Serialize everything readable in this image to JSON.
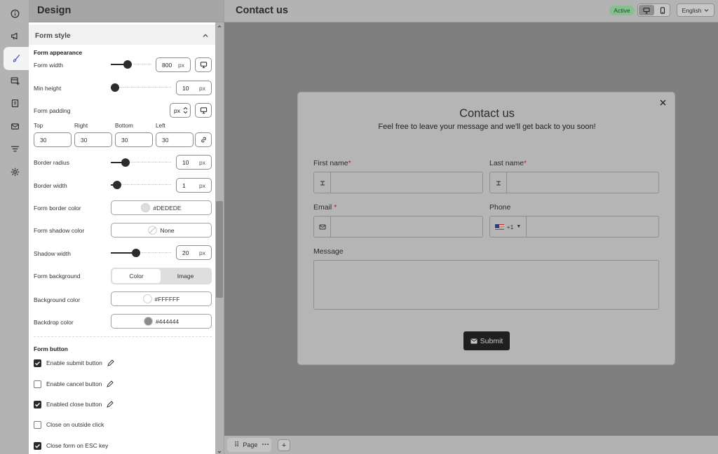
{
  "rail": {
    "items": [
      {
        "icon": "info-icon"
      },
      {
        "icon": "megaphone-icon"
      },
      {
        "icon": "brush-icon",
        "active": true
      },
      {
        "icon": "form-add-icon"
      },
      {
        "icon": "document-icon"
      },
      {
        "icon": "mail-icon"
      },
      {
        "icon": "filter-icon"
      },
      {
        "icon": "gear-icon"
      }
    ]
  },
  "panel": {
    "title": "Design",
    "section_title": "Form style",
    "appearance_heading": "Form appearance",
    "form_width": {
      "label": "Form width",
      "value": "800",
      "unit": "px",
      "slider_level": 0.39
    },
    "min_height": {
      "label": "Min height",
      "value": "10",
      "unit": "px",
      "slider_level": 0.0
    },
    "form_padding": {
      "label": "Form padding",
      "unit": "px"
    },
    "padding": {
      "top_label": "Top",
      "right_label": "Right",
      "bottom_label": "Bottom",
      "left_label": "Left",
      "top": "30",
      "right": "30",
      "bottom": "30",
      "left": "30"
    },
    "border_radius": {
      "label": "Border radius",
      "value": "10",
      "unit": "px",
      "slider_level": 0.2
    },
    "border_width": {
      "label": "Border width",
      "value": "1",
      "unit": "px",
      "slider_level": 0.04
    },
    "form_border_color": {
      "label": "Form border color",
      "value": "#DEDEDE",
      "swatch": "#dedede"
    },
    "form_shadow_color": {
      "label": "Form shadow color",
      "value": "None"
    },
    "shadow_width": {
      "label": "Shadow width",
      "value": "20",
      "unit": "px",
      "slider_level": 0.4
    },
    "form_background": {
      "label": "Form background",
      "options": [
        "Color",
        "Image"
      ],
      "selected": "Color"
    },
    "background_color": {
      "label": "Background color",
      "value": "#FFFFFF",
      "swatch": "#ffffff"
    },
    "backdrop_color": {
      "label": "Backdrop color",
      "value": "#444444",
      "swatch": "#8c8c8c"
    },
    "button_heading": "Form button",
    "checkboxes": [
      {
        "label": "Enable submit button",
        "checked": true,
        "editable": true
      },
      {
        "label": "Enable cancel button",
        "checked": false,
        "editable": true
      },
      {
        "label": "Enabled close button",
        "checked": true,
        "editable": true
      },
      {
        "label": "Close on outside click",
        "checked": false,
        "editable": false
      },
      {
        "label": "Close form on ESC key",
        "checked": true,
        "editable": false
      }
    ]
  },
  "topbar": {
    "title": "Contact us",
    "status": "Active",
    "language": "English"
  },
  "bottombar": {
    "page_tab": "Page"
  },
  "form": {
    "title": "Contact us",
    "subtitle": "Feel free to leave your message and we'll get back to you soon!",
    "first_name_label": "First name",
    "last_name_label": "Last name",
    "email_label": "Email",
    "phone_label": "Phone",
    "phone_code": "+1",
    "message_label": "Message",
    "required_mark": "*",
    "submit_label": "Submit"
  },
  "colors": {
    "status_badge": "#86bf90",
    "submit_button": "#1f1f1f",
    "required": "#b6201b"
  }
}
